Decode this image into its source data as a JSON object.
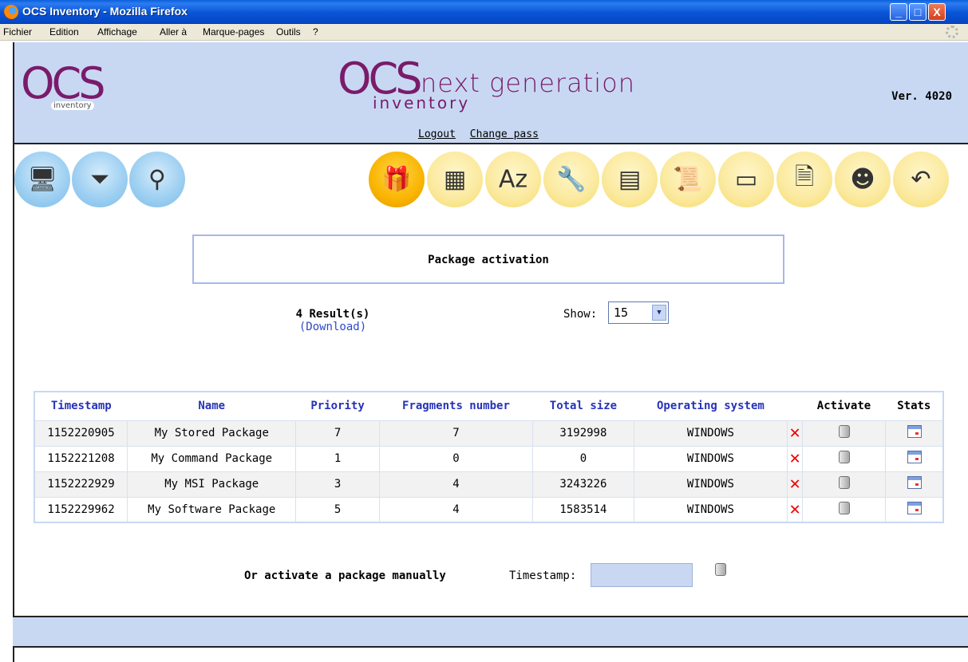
{
  "window": {
    "title": "OCS Inventory - Mozilla Firefox",
    "buttons": [
      "_",
      "□",
      "X"
    ]
  },
  "menu": [
    "Fichier",
    "Edition",
    "Affichage",
    "Aller à",
    "Marque-pages",
    "Outils",
    "?"
  ],
  "header": {
    "logo_left_text": "OCS",
    "logo_left_small": "inventory",
    "logo_mid_text": "OCS",
    "logo_mid_next": "next generation",
    "logo_mid_inventory": "inventory",
    "version": "Ver. 4020",
    "links": [
      "Logout",
      "Change pass"
    ]
  },
  "toolbar": {
    "left_icons": [
      "computers-icon",
      "filter-icon",
      "search-icon"
    ],
    "right_icons": [
      "package-gift-icon",
      "firewall-icon",
      "dictionary-icon",
      "tools-icon",
      "registry-icon",
      "script-icon",
      "network-card-icon",
      "document-icon",
      "help-icon",
      "back-icon"
    ]
  },
  "page": {
    "title": "Package activation"
  },
  "results": {
    "count": "4 Result(s)",
    "download": "(Download)"
  },
  "show": {
    "label": "Show:",
    "value": "15"
  },
  "table": {
    "headers": [
      "Timestamp",
      "Name",
      "Priority",
      "Fragments number",
      "Total size",
      "Operating system",
      "Activate",
      "Stats"
    ],
    "rows": [
      {
        "timestamp": "1152220905",
        "name": "My Stored Package",
        "priority": "7",
        "fragments": "7",
        "size": "3192998",
        "os": "WINDOWS"
      },
      {
        "timestamp": "1152221208",
        "name": "My Command Package",
        "priority": "1",
        "fragments": "0",
        "size": "0",
        "os": "WINDOWS"
      },
      {
        "timestamp": "1152222929",
        "name": "My MSI Package",
        "priority": "3",
        "fragments": "4",
        "size": "3243226",
        "os": "WINDOWS"
      },
      {
        "timestamp": "1152229962",
        "name": "My Software Package",
        "priority": "5",
        "fragments": "4",
        "size": "1583514",
        "os": "WINDOWS"
      }
    ]
  },
  "manual": {
    "label": "Or activate a package manually",
    "ts_label": "Timestamp:",
    "ts_value": ""
  },
  "colors": {
    "header_band": "#c8d8f3",
    "header_text": "#2633b8",
    "logo": "#7a1b6a",
    "delete": "#e00000"
  }
}
